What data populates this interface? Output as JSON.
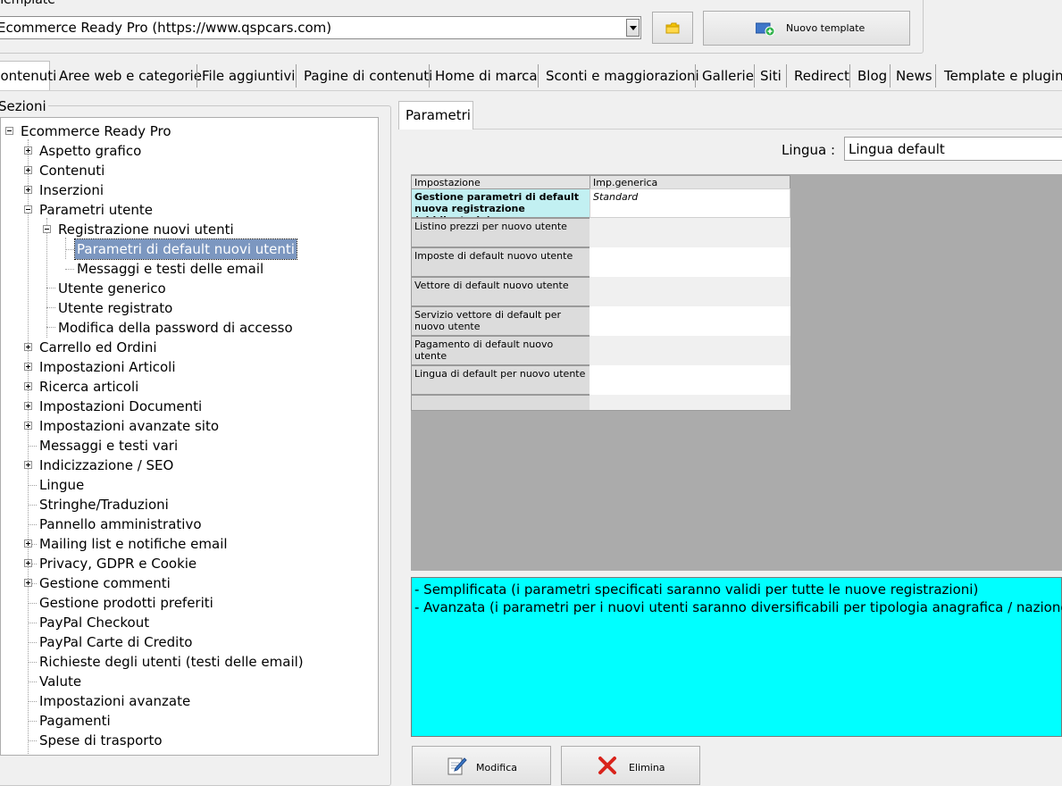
{
  "template": {
    "label": "Template",
    "selected": "Ecommerce Ready Pro (https://www.qspcars.com)",
    "new_template_label": "Nuovo template"
  },
  "tabs": [
    "Contenuti",
    "Aree web e categorie",
    "File aggiuntivi",
    "Pagine di contenuti",
    "Home di marca",
    "Sconti e maggiorazioni",
    "Gallerie",
    "Siti",
    "Redirect",
    "Blog",
    "News",
    "Template e plugins"
  ],
  "sections": {
    "label": "Sezioni",
    "tree": [
      {
        "label": "Ecommerce Ready Pro",
        "state": "minus"
      },
      {
        "label": "Aspetto grafico",
        "state": "plus"
      },
      {
        "label": "Contenuti",
        "state": "plus"
      },
      {
        "label": "Inserzioni",
        "state": "plus"
      },
      {
        "label": "Parametri utente",
        "state": "minus"
      },
      {
        "label": "Registrazione nuovi utenti",
        "state": "minus"
      },
      {
        "label": "Parametri di default nuovi utenti",
        "state": "selected"
      },
      {
        "label": "Messaggi e testi delle email",
        "state": "leaf"
      },
      {
        "label": "Utente generico",
        "state": "leaf"
      },
      {
        "label": "Utente registrato",
        "state": "leaf"
      },
      {
        "label": "Modifica della password di accesso",
        "state": "leaf"
      },
      {
        "label": "Carrello ed Ordini",
        "state": "plus"
      },
      {
        "label": "Impostazioni Articoli",
        "state": "plus"
      },
      {
        "label": "Ricerca articoli",
        "state": "plus"
      },
      {
        "label": "Impostazioni Documenti",
        "state": "plus"
      },
      {
        "label": "Impostazioni avanzate sito",
        "state": "plus"
      },
      {
        "label": "Messaggi e testi vari",
        "state": "leaf"
      },
      {
        "label": "Indicizzazione / SEO",
        "state": "plus"
      },
      {
        "label": "Lingue",
        "state": "leaf"
      },
      {
        "label": "Stringhe/Traduzioni",
        "state": "leaf"
      },
      {
        "label": "Pannello amministrativo",
        "state": "leaf"
      },
      {
        "label": "Mailing list e notifiche email",
        "state": "plus"
      },
      {
        "label": "Privacy, GDPR e Cookie",
        "state": "plus"
      },
      {
        "label": "Gestione commenti",
        "state": "plus"
      },
      {
        "label": "Gestione prodotti preferiti",
        "state": "leaf"
      },
      {
        "label": "PayPal Checkout",
        "state": "leaf"
      },
      {
        "label": "PayPal Carte di Credito",
        "state": "leaf"
      },
      {
        "label": "Richieste degli utenti (testi delle email)",
        "state": "leaf"
      },
      {
        "label": "Valute",
        "state": "leaf"
      },
      {
        "label": "Impostazioni avanzate",
        "state": "leaf"
      },
      {
        "label": "Pagamenti",
        "state": "leaf"
      },
      {
        "label": "Spese di trasporto",
        "state": "leaf"
      }
    ]
  },
  "params": {
    "tab_label": "Parametri",
    "lingua_label": "Lingua :",
    "lingua_value": "Lingua default",
    "grid": {
      "headers": [
        "Impostazione",
        "Imp.generica"
      ],
      "rows": [
        {
          "setting": "Gestione parametri di default nuova registrazione (obbligatorio)",
          "value": "Standard"
        },
        {
          "setting": "Listino prezzi per nuovo utente",
          "value": ""
        },
        {
          "setting": "Imposte di default nuovo utente",
          "value": ""
        },
        {
          "setting": "Vettore di default nuovo utente",
          "value": ""
        },
        {
          "setting": "Servizio vettore di default per nuovo utente",
          "value": ""
        },
        {
          "setting": "Pagamento di default nuovo utente",
          "value": ""
        },
        {
          "setting": "Lingua di default per nuovo utente",
          "value": ""
        }
      ]
    },
    "description": [
      "- Semplificata (i parametri specificati saranno validi per tutte le nuove registrazioni)",
      "- Avanzata (i parametri per i nuovi utenti saranno diversificabili per tipologia anagrafica / nazione)"
    ],
    "modify_label": "Modifica",
    "delete_label": "Elimina"
  },
  "colors": {
    "selection": "#7c97c0",
    "highlight_cell": "#c2f0f2",
    "description_bg": "#00ffff",
    "grid_bg": "#ababab"
  }
}
